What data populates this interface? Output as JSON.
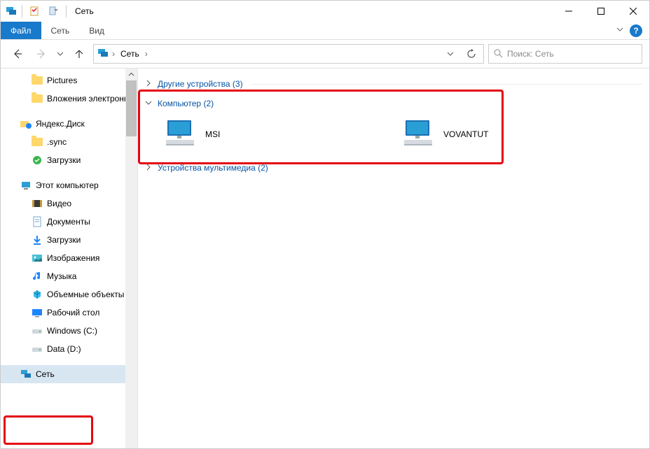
{
  "window": {
    "title": "Сеть"
  },
  "ribbon": {
    "file": "Файл",
    "tabs": [
      "Сеть",
      "Вид"
    ]
  },
  "address": {
    "crumb": "Сеть"
  },
  "search": {
    "placeholder": "Поиск: Сеть"
  },
  "sidebar": {
    "items": [
      {
        "label": "Pictures",
        "icon": "folder",
        "indent": 1
      },
      {
        "label": "Вложения электронной почты",
        "icon": "folder",
        "indent": 1
      },
      {
        "spacer": true
      },
      {
        "label": "Яндекс.Диск",
        "icon": "yadisk",
        "indent": 0
      },
      {
        "label": ".sync",
        "icon": "folder",
        "indent": 1
      },
      {
        "label": "Загрузки",
        "icon": "check",
        "indent": 1
      },
      {
        "spacer": true
      },
      {
        "label": "Этот компьютер",
        "icon": "pc",
        "indent": 0
      },
      {
        "label": "Видео",
        "icon": "video",
        "indent": 1
      },
      {
        "label": "Документы",
        "icon": "docs",
        "indent": 1
      },
      {
        "label": "Загрузки",
        "icon": "download",
        "indent": 1
      },
      {
        "label": "Изображения",
        "icon": "images",
        "indent": 1
      },
      {
        "label": "Музыка",
        "icon": "music",
        "indent": 1
      },
      {
        "label": "Объемные объекты",
        "icon": "3d",
        "indent": 1
      },
      {
        "label": "Рабочий стол",
        "icon": "desktop",
        "indent": 1
      },
      {
        "label": "Windows (C:)",
        "icon": "drive",
        "indent": 1
      },
      {
        "label": "Data (D:)",
        "icon": "drive",
        "indent": 1
      },
      {
        "spacer": true
      },
      {
        "label": "Сеть",
        "icon": "network",
        "indent": 0,
        "selected": true
      }
    ]
  },
  "content": {
    "groups": [
      {
        "title": "Другие устройства (3)",
        "expanded": false,
        "items": []
      },
      {
        "title": "Компьютер (2)",
        "expanded": true,
        "items": [
          {
            "name": "MSI"
          },
          {
            "name": "VOVANTUT"
          }
        ]
      },
      {
        "title": "Устройства мультимедиа (2)",
        "expanded": false,
        "items": []
      }
    ]
  }
}
